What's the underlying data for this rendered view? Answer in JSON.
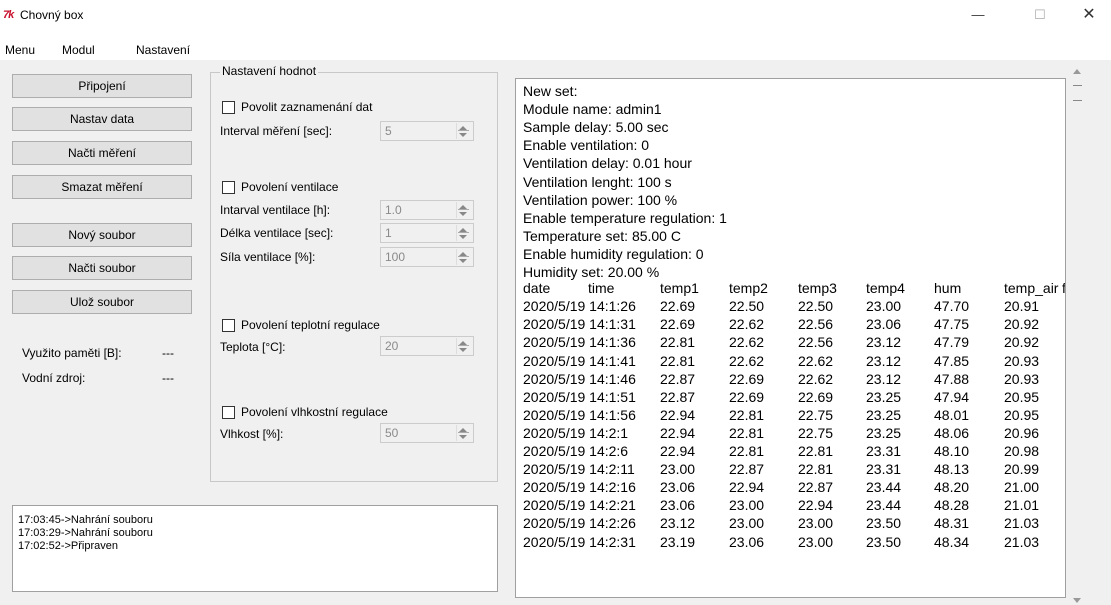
{
  "window": {
    "title": "Chovný box",
    "icon_text": "7k"
  },
  "window_controls": {
    "minimize": "—",
    "maximize": "☐",
    "close": "✕"
  },
  "menu": [
    "Menu",
    "Modul",
    "Nastavení"
  ],
  "left_buttons": {
    "pripojeni": "Připojení",
    "nastav_data": "Nastav data",
    "nacti_mereni": "Načti měření",
    "smazat_mereni": "Smazat měření",
    "novy_soubor": "Nový soubor",
    "nacti_soubor": "Načti soubor",
    "uloz_soubor": "Ulož soubor"
  },
  "info": {
    "memory_label": "Využito paměti [B]:",
    "memory_value": "---",
    "water_label": "Vodní zdroj:",
    "water_value": "---"
  },
  "log": [
    "17:03:45->Nahrání souboru",
    "17:03:29->Nahrání souboru",
    "17:02:52->Připraven"
  ],
  "settings": {
    "legend": "Nastavení hodnot",
    "enable_logging": "Povolit zaznamenání dat",
    "interval_label": "Interval měření [sec]:",
    "interval_value": "5",
    "enable_ventilation": "Povolení ventilace",
    "vent_interval_label": "Intarval ventilace [h]:",
    "vent_interval_value": "1.0",
    "vent_length_label": "Délka ventilace [sec]:",
    "vent_length_value": "1",
    "vent_power_label": "Síla ventilace [%]:",
    "vent_power_value": "100",
    "enable_temp": "Povolení teplotní regulace",
    "temp_label": "Teplota [°C]:",
    "temp_value": "20",
    "enable_hum": "Povolení vlhkostní regulace",
    "hum_label": "Vlhkost [%]:",
    "hum_value": "50"
  },
  "output": {
    "lines": [
      "New set:",
      "Module name: admin1",
      "Sample delay: 5.00 sec",
      "Enable ventilation: 0",
      "Ventilation delay: 0.01 hour",
      "Ventilation lenght: 100 s",
      "Ventilation power: 100 %",
      "Enable temperature regulation: 1",
      "Temperature set: 85.00 C",
      "Enable humidity regulation: 0",
      "Humidity set: 20.00 %"
    ],
    "table_header": [
      "date",
      "time",
      "temp1",
      "temp2",
      "temp3",
      "temp4",
      "hum",
      "temp_air",
      "f"
    ],
    "table_rows": [
      [
        "2020/5/19 14:1:26",
        "22.69",
        "22.50",
        "22.50",
        "23.00",
        "47.70",
        "20.91",
        "-"
      ],
      [
        "2020/5/19 14:1:31",
        "22.69",
        "22.62",
        "22.56",
        "23.06",
        "47.75",
        "20.92",
        "-"
      ],
      [
        "2020/5/19 14:1:36",
        "22.81",
        "22.62",
        "22.56",
        "23.12",
        "47.79",
        "20.92",
        "-"
      ],
      [
        "2020/5/19 14:1:41",
        "22.81",
        "22.62",
        "22.62",
        "23.12",
        "47.85",
        "20.93",
        "-"
      ],
      [
        "2020/5/19 14:1:46",
        "22.87",
        "22.69",
        "22.62",
        "23.12",
        "47.88",
        "20.93",
        "-"
      ],
      [
        "2020/5/19 14:1:51",
        "22.87",
        "22.69",
        "22.69",
        "23.25",
        "47.94",
        "20.95",
        "-"
      ],
      [
        "2020/5/19 14:1:56",
        "22.94",
        "22.81",
        "22.75",
        "23.25",
        "48.01",
        "20.95",
        "-"
      ],
      [
        "2020/5/19 14:2:1",
        "22.94",
        "22.81",
        "22.75",
        "23.25",
        "48.06",
        "20.96",
        "-"
      ],
      [
        "2020/5/19 14:2:6",
        "22.94",
        "22.81",
        "22.81",
        "23.31",
        "48.10",
        "20.98",
        "-"
      ],
      [
        "2020/5/19 14:2:11",
        "23.00",
        "22.87",
        "22.81",
        "23.31",
        "48.13",
        "20.99",
        "-"
      ],
      [
        "2020/5/19 14:2:16",
        "23.06",
        "22.94",
        "22.87",
        "23.44",
        "48.20",
        "21.00",
        "-"
      ],
      [
        "2020/5/19 14:2:21",
        "23.06",
        "23.00",
        "22.94",
        "23.44",
        "48.28",
        "21.01",
        "-"
      ],
      [
        "2020/5/19 14:2:26",
        "23.12",
        "23.00",
        "23.00",
        "23.50",
        "48.31",
        "21.03",
        "-"
      ],
      [
        "2020/5/19 14:2:31",
        "23.19",
        "23.06",
        "23.00",
        "23.50",
        "48.34",
        "21.03",
        "-"
      ]
    ]
  }
}
